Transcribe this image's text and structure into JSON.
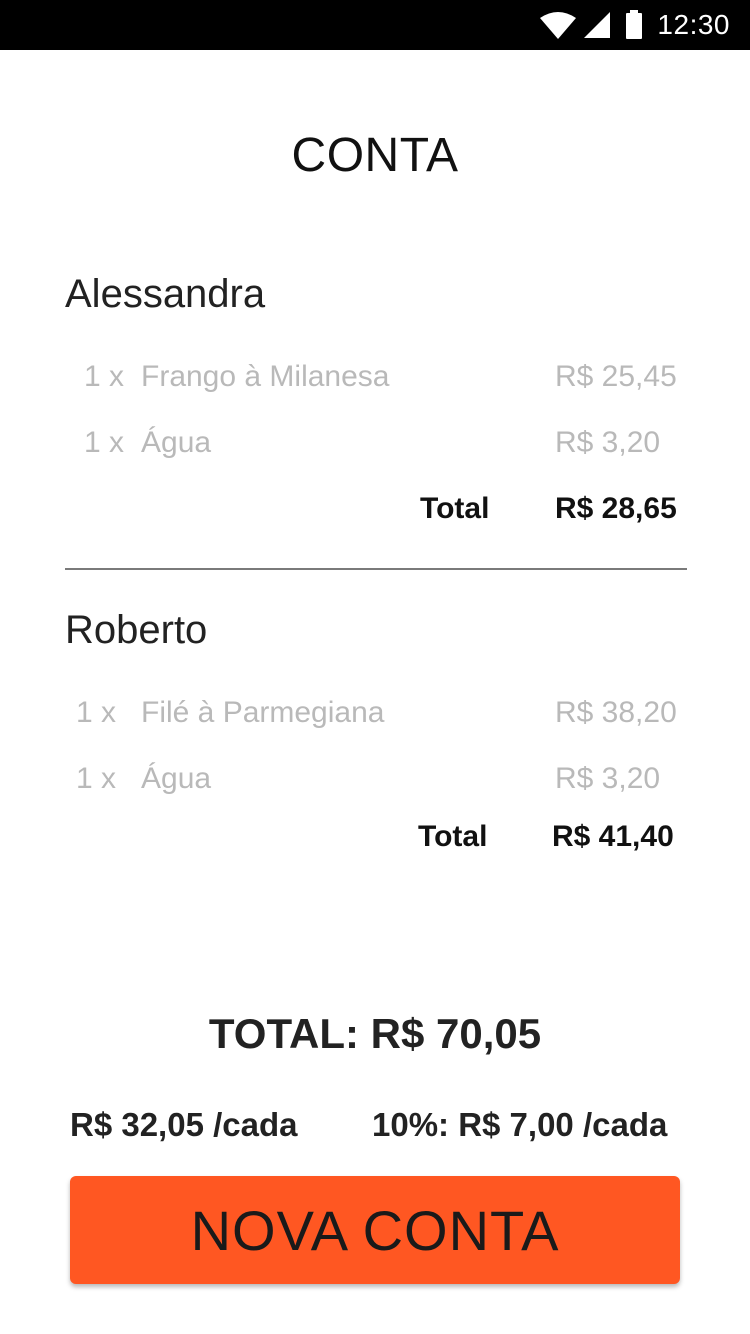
{
  "status_bar": {
    "time": "12:30",
    "icons": [
      "wifi-icon",
      "signal-icon",
      "battery-icon"
    ]
  },
  "page_title": "CONTA",
  "people": [
    {
      "name": "Alessandra",
      "items": [
        {
          "qty": "1 x",
          "desc": "Frango à Milanesa",
          "price": "R$ 25,45"
        },
        {
          "qty": "1 x",
          "desc": "Água",
          "price": "R$ 3,20"
        }
      ],
      "total_label": "Total",
      "total_value": "R$ 28,65"
    },
    {
      "name": "Roberto",
      "items": [
        {
          "qty": "1 x",
          "desc": "Filé à Parmegiana",
          "price": "R$ 38,20"
        },
        {
          "qty": "1 x",
          "desc": "Água",
          "price": "R$ 3,20"
        }
      ],
      "total_label": "Total",
      "total_value": "R$ 41,40"
    }
  ],
  "grand_total": "TOTAL: R$ 70,05",
  "per_person": "R$ 32,05 /cada",
  "tip_per_person": "10%: R$ 7,00 /cada",
  "new_bill_button": "NOVA CONTA",
  "colors": {
    "accent": "#ff5722",
    "status_bar": "#000000",
    "item_text": "#b9b9b9",
    "divider": "#7a7a7a"
  }
}
